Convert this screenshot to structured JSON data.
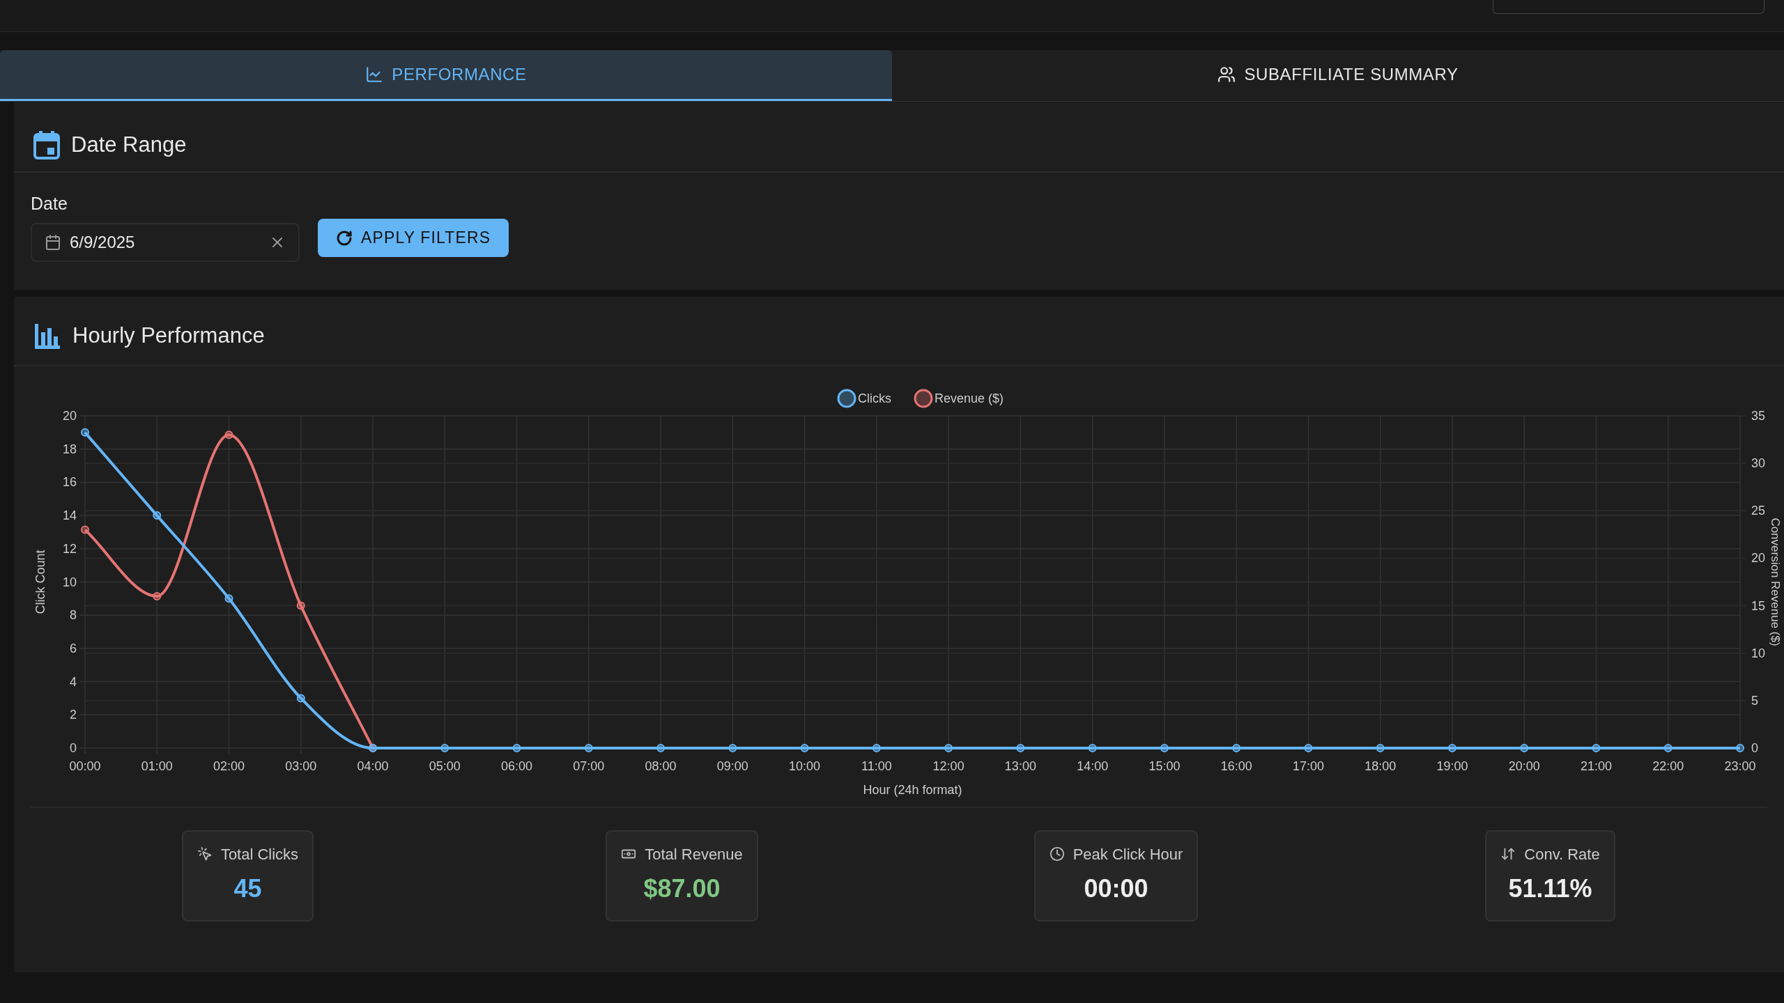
{
  "tabs": [
    {
      "label": "PERFORMANCE",
      "kind": "chart",
      "selected": true
    },
    {
      "label": "SUBAFFILIATE SUMMARY",
      "kind": "users",
      "selected": false
    }
  ],
  "date_range": {
    "title": "Date Range",
    "date_label": "Date",
    "date_value": "6/9/2025",
    "apply_button": "APPLY FILTERS"
  },
  "hourly_performance": {
    "title": "Hourly Performance",
    "chart_data": {
      "type": "line",
      "xlabel": "Hour (24h format)",
      "ylabel": "Click Count",
      "y2label": "Conversion Revenue ($)",
      "categories": [
        "00:00",
        "01:00",
        "02:00",
        "03:00",
        "04:00",
        "05:00",
        "06:00",
        "07:00",
        "08:00",
        "09:00",
        "10:00",
        "11:00",
        "12:00",
        "13:00",
        "14:00",
        "15:00",
        "16:00",
        "17:00",
        "18:00",
        "19:00",
        "20:00",
        "21:00",
        "22:00",
        "23:00"
      ],
      "series": [
        {
          "name": "Clicks",
          "color": "#64b5f6",
          "axis": "y",
          "marker": "circle",
          "values": [
            19,
            14,
            9,
            3,
            0,
            0,
            0,
            0,
            0,
            0,
            0,
            0,
            0,
            0,
            0,
            0,
            0,
            0,
            0,
            0,
            0,
            0,
            0,
            0
          ]
        },
        {
          "name": "Revenue ($)",
          "color": "#e57373",
          "axis": "y2",
          "marker": "circle",
          "values": [
            23,
            16,
            33,
            15,
            0,
            null,
            null,
            null,
            null,
            null,
            null,
            null,
            null,
            null,
            null,
            null,
            null,
            null,
            null,
            null,
            null,
            null,
            null,
            null
          ]
        }
      ],
      "grid": true,
      "legend": "top",
      "ylim": [
        0,
        20
      ],
      "yticks": [
        0,
        2,
        4,
        6,
        8,
        10,
        12,
        14,
        16,
        18,
        20
      ],
      "y2lim": [
        0,
        35
      ],
      "y2ticks": [
        0,
        5,
        10,
        15,
        20,
        25,
        30,
        35
      ]
    },
    "stats": [
      {
        "kind": "clicks",
        "label": "Total Clicks",
        "value": "45",
        "color": "#64b5f6"
      },
      {
        "kind": "revenue",
        "label": "Total Revenue",
        "value": "$87.00",
        "color": "#81c784"
      },
      {
        "kind": "time",
        "label": "Peak Click Hour",
        "value": "00:00",
        "color": "#eeeeee"
      },
      {
        "kind": "rate",
        "label": "Conv. Rate",
        "value": "51.11%",
        "color": "#eeeeee"
      }
    ]
  }
}
